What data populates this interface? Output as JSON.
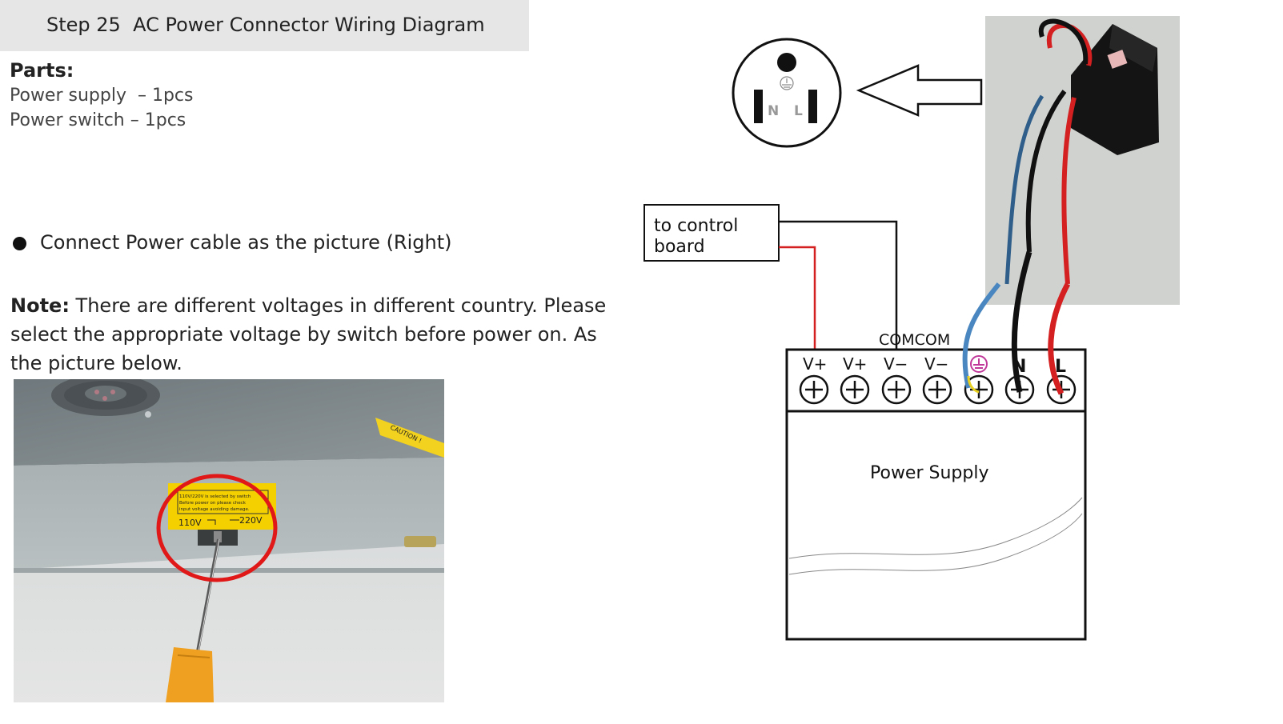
{
  "header": {
    "title": "Step 25  AC Power Connector Wiring Diagram"
  },
  "parts": {
    "heading": "Parts:",
    "items": [
      "Power supply  – 1pcs",
      "Power switch – 1pcs"
    ]
  },
  "instruction": {
    "text": "Connect Power cable as the picture (Right)"
  },
  "note": {
    "label": "Note:",
    "text": " There are different voltages in different country. Please select the appropriate voltage by switch before power on. As the picture below."
  },
  "photo": {
    "label_text": "110V/220V is selected by switch Before power on please check input voltage avoiding damage.",
    "label_110": "110V",
    "label_220": "220V",
    "caution": "CAUTION !"
  },
  "diagram": {
    "control_board_label_1": "to  control",
    "control_board_label_2": "board",
    "com_label": "COMCOM",
    "terminals": [
      "V+",
      "V+",
      "V−",
      "V−",
      "⏚",
      "N",
      "L"
    ],
    "power_supply_label": "Power  Supply",
    "outlet_n": "N",
    "outlet_l": "L"
  },
  "colors": {
    "wire_red": "#d42020",
    "wire_black": "#111111",
    "wire_blue": "#4a86c0",
    "earth_symbol": "#c0399a"
  }
}
